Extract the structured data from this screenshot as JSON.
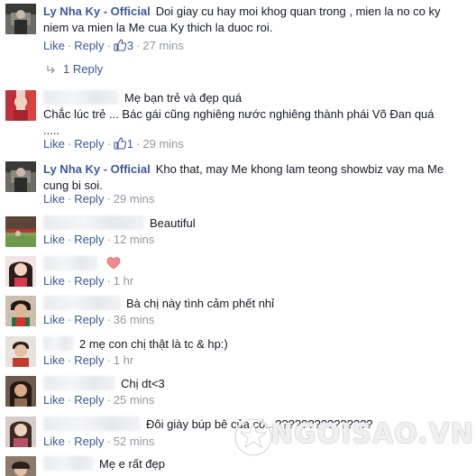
{
  "labels": {
    "like": "Like",
    "reply": "Reply",
    "separator": "·"
  },
  "comments": [
    {
      "author": "Ly Nha Ky - Official",
      "text": "Doi giay cu hay moi khog quan trong , mien la no co ky niem va mien la Me cua Ky thich la duoc roi.",
      "likes": "3",
      "time": "27 mins",
      "replies_label": "1 Reply"
    },
    {
      "author": "",
      "text_line1": "Mẹ bạn trẻ và đẹp quá",
      "text_line2": "Chắc lúc trẻ ... Bác gái cũng nghiêng nước nghiêng thành phái Võ Đan quá",
      "text_line3": ".....",
      "likes": "1",
      "time": "29 mins"
    },
    {
      "author": "Ly Nha Ky - Official",
      "text": "Kho that, may Me khong lam teong showbiz vay ma Me cung bi soi.",
      "time": "29 mins"
    },
    {
      "author": "",
      "text": "Beautiful",
      "time": "12 mins"
    },
    {
      "author": "",
      "text": "",
      "icon": "heart-icon",
      "time": "1 hr"
    },
    {
      "author": "",
      "text": "Bà chị này tình cảm phết nhỉ",
      "time": "36 mins"
    },
    {
      "author": "",
      "text": "2 mẹ con chị thật là tc & hp:)",
      "time": "1 hr"
    },
    {
      "author": "",
      "text": "Chị dt<3",
      "time": "25 mins"
    },
    {
      "author": "",
      "text": "Đôi giày búp bê của cô...???????????????",
      "time": "52 mins"
    },
    {
      "author": "",
      "text": "Mẹ e rất đẹp"
    }
  ],
  "watermark": "NGOISAO.VN",
  "colors": {
    "link": "#3b5998",
    "meta": "#9197a3",
    "text": "#141823"
  }
}
